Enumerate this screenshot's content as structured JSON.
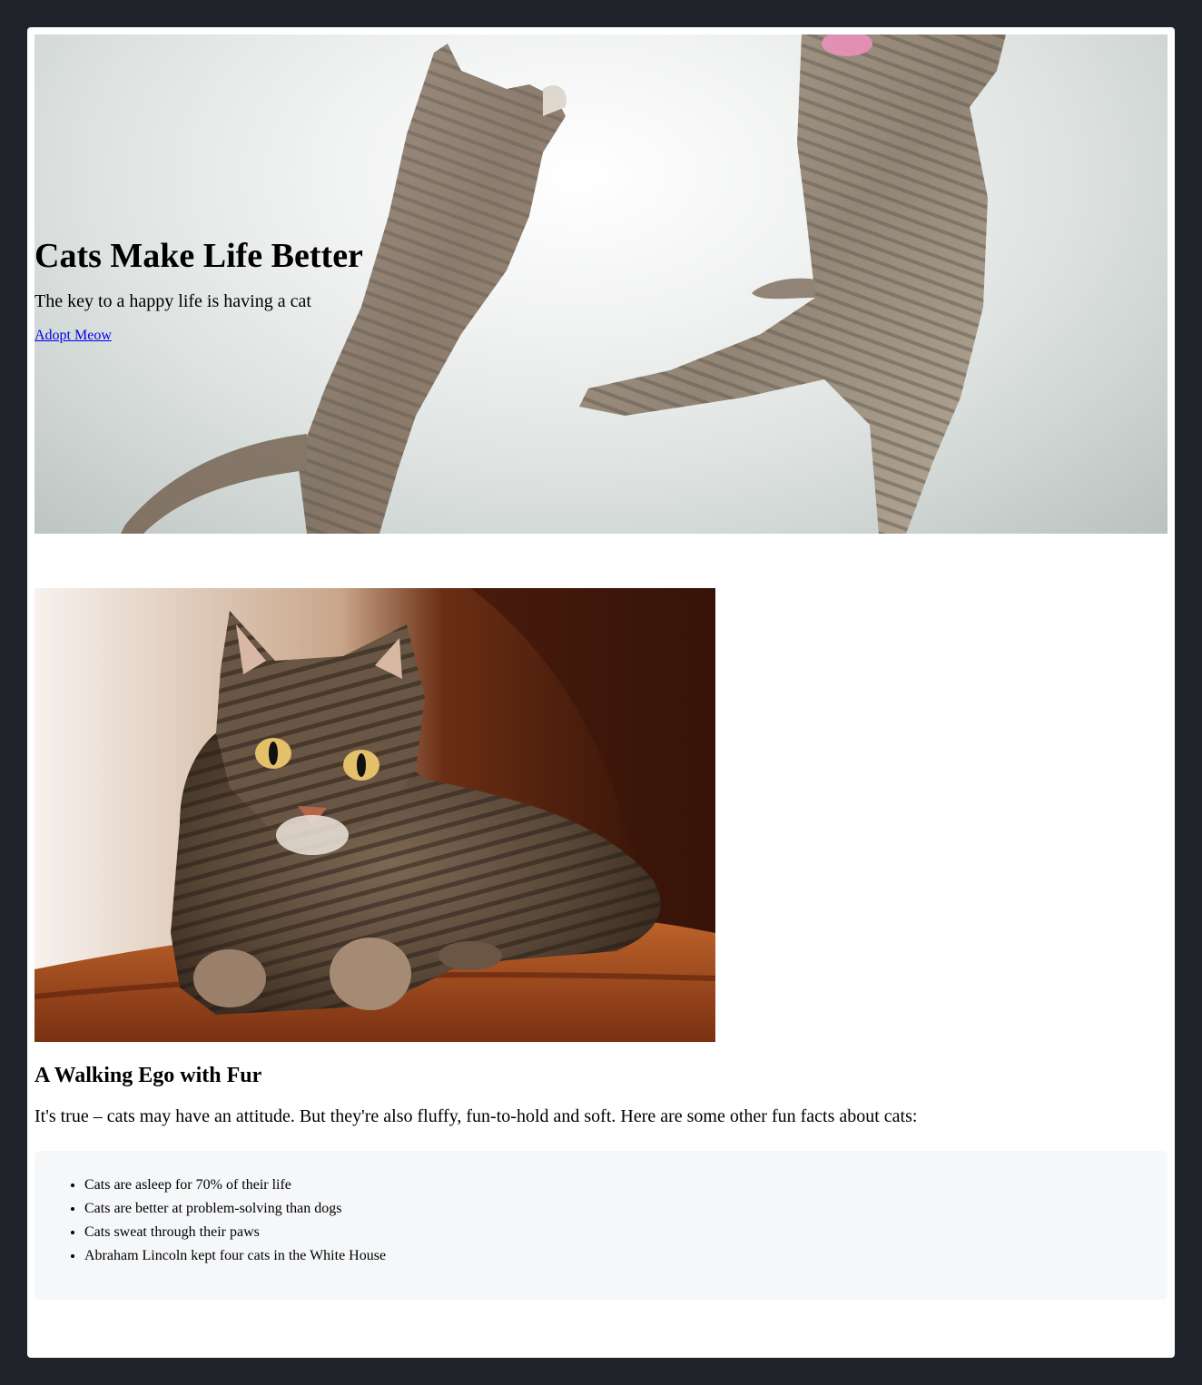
{
  "hero": {
    "title": "Cats Make Life Better",
    "subtitle": "The key to a happy life is having a cat",
    "link_label": "Adopt Meow",
    "background_image": "two-tabby-cats-jumping"
  },
  "feature": {
    "image": "tabby-cat-on-armchair",
    "heading": "A Walking Ego with Fur",
    "intro": "It's true – cats may have an attitude. But they're also fluffy, fun-to-hold and soft. Here are some other fun facts about cats:",
    "facts": [
      "Cats are asleep for 70% of their life",
      "Cats are better at problem-solving than dogs",
      "Cats sweat through their paws",
      "Abraham Lincoln kept four cats in the White House"
    ]
  },
  "colors": {
    "frame": "#20232a",
    "page": "#ffffff",
    "link": "#0000ee",
    "facts_box": "#f6f7f9"
  }
}
